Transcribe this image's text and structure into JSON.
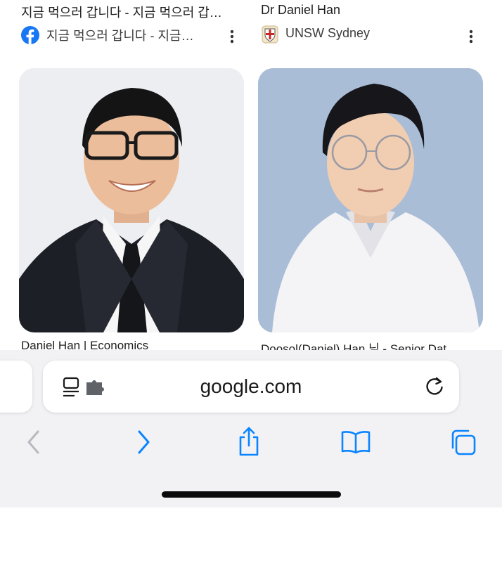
{
  "results": [
    {
      "title": "지금 먹으러 갑니다 - 지금 먹으러 갑…",
      "source": "지금 먹으러 갑니다 - 지금…",
      "caption": "Daniel Han | Economics",
      "source_icon": "facebook-logo",
      "colors": {
        "icon_bg": "#1877f2",
        "photo_bg": "#e9eaee"
      }
    },
    {
      "title": "Dr Daniel Han",
      "source": "UNSW Sydney",
      "caption": "Doosol(Daniel) Han 님 - Senior Dat…",
      "source_icon": "unsw-crest",
      "colors": {
        "icon_bg": "#f4e6c8",
        "photo_bg": "#a9bdd6"
      }
    }
  ],
  "browser": {
    "url": "google.com",
    "icons": [
      "reader-icon",
      "extension-icon",
      "reload-icon",
      "back-icon",
      "forward-icon",
      "share-icon",
      "bookmarks-icon",
      "tabs-icon"
    ],
    "colors": {
      "accent": "#0a84ff",
      "disabled": "#b8b8be",
      "toolbar_bg": "#f2f2f4"
    }
  }
}
